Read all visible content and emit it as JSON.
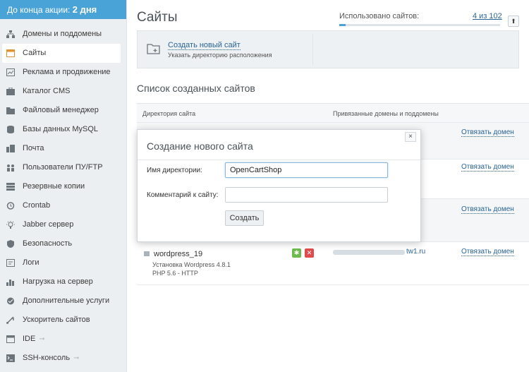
{
  "promo": {
    "text": "До конца акции:",
    "days": "2 дня"
  },
  "sidebar": {
    "items": [
      {
        "label": "Домены и поддомены",
        "icon": "domains-icon"
      },
      {
        "label": "Сайты",
        "icon": "sites-icon",
        "active": true
      },
      {
        "label": "Реклама и продвижение",
        "icon": "chart-icon"
      },
      {
        "label": "Каталог CMS",
        "icon": "cms-icon"
      },
      {
        "label": "Файловый менеджер",
        "icon": "folder-icon"
      },
      {
        "label": "Базы данных MySQL",
        "icon": "database-icon"
      },
      {
        "label": "Почта",
        "icon": "mail-icon"
      },
      {
        "label": "Пользователи ПУ/FTP",
        "icon": "users-icon"
      },
      {
        "label": "Резервные копии",
        "icon": "backup-icon"
      },
      {
        "label": "Crontab",
        "icon": "clock-icon"
      },
      {
        "label": "Jabber сервер",
        "icon": "bulb-icon"
      },
      {
        "label": "Безопасность",
        "icon": "shield-icon"
      },
      {
        "label": "Логи",
        "icon": "logs-icon"
      },
      {
        "label": "Нагрузка на сервер",
        "icon": "load-icon"
      },
      {
        "label": "Дополнительные услуги",
        "icon": "services-icon"
      },
      {
        "label": "Ускоритель сайтов",
        "icon": "speed-icon"
      },
      {
        "label": "IDE",
        "icon": "ide-icon",
        "arrow": "➞"
      },
      {
        "label": "SSH-консоль",
        "icon": "terminal-icon",
        "arrow": "➞"
      }
    ]
  },
  "header": {
    "title": "Сайты",
    "usage_label": "Использовано сайтов:",
    "usage_value": "4 из 102",
    "usage_fraction": 0.04
  },
  "create": {
    "link": "Создать новый сайт",
    "hint": "Указать директорию расположения"
  },
  "list": {
    "title": "Список созданных сайтов",
    "col_dir": "Директория сайта",
    "col_domains": "Привязанные домены и поддомены",
    "unlink_label": "Отвязать домен",
    "sites": [
      {
        "name": "",
        "sub1": "",
        "sub2": "",
        "domain": ""
      },
      {
        "name": "",
        "sub1": "",
        "sub2": "",
        "domain": ""
      },
      {
        "name": "",
        "sub1": "",
        "sub2": "",
        "domain": ""
      },
      {
        "name": "wordpress_19",
        "sub1": "Установка Wordpress 4.8.1",
        "sub2": "PHP 5.6 - HTTP",
        "domain": "tw1.ru"
      }
    ]
  },
  "dialog": {
    "title": "Создание нового сайта",
    "close": "×",
    "dir_label": "Имя директории:",
    "dir_value": "OpenCartShop",
    "comment_label": "Комментарий к сайту:",
    "comment_value": "",
    "submit": "Создать"
  },
  "colors": {
    "accent": "#4aa3d6",
    "link": "#2a6496",
    "sidebar_bg": "#eceff1"
  }
}
